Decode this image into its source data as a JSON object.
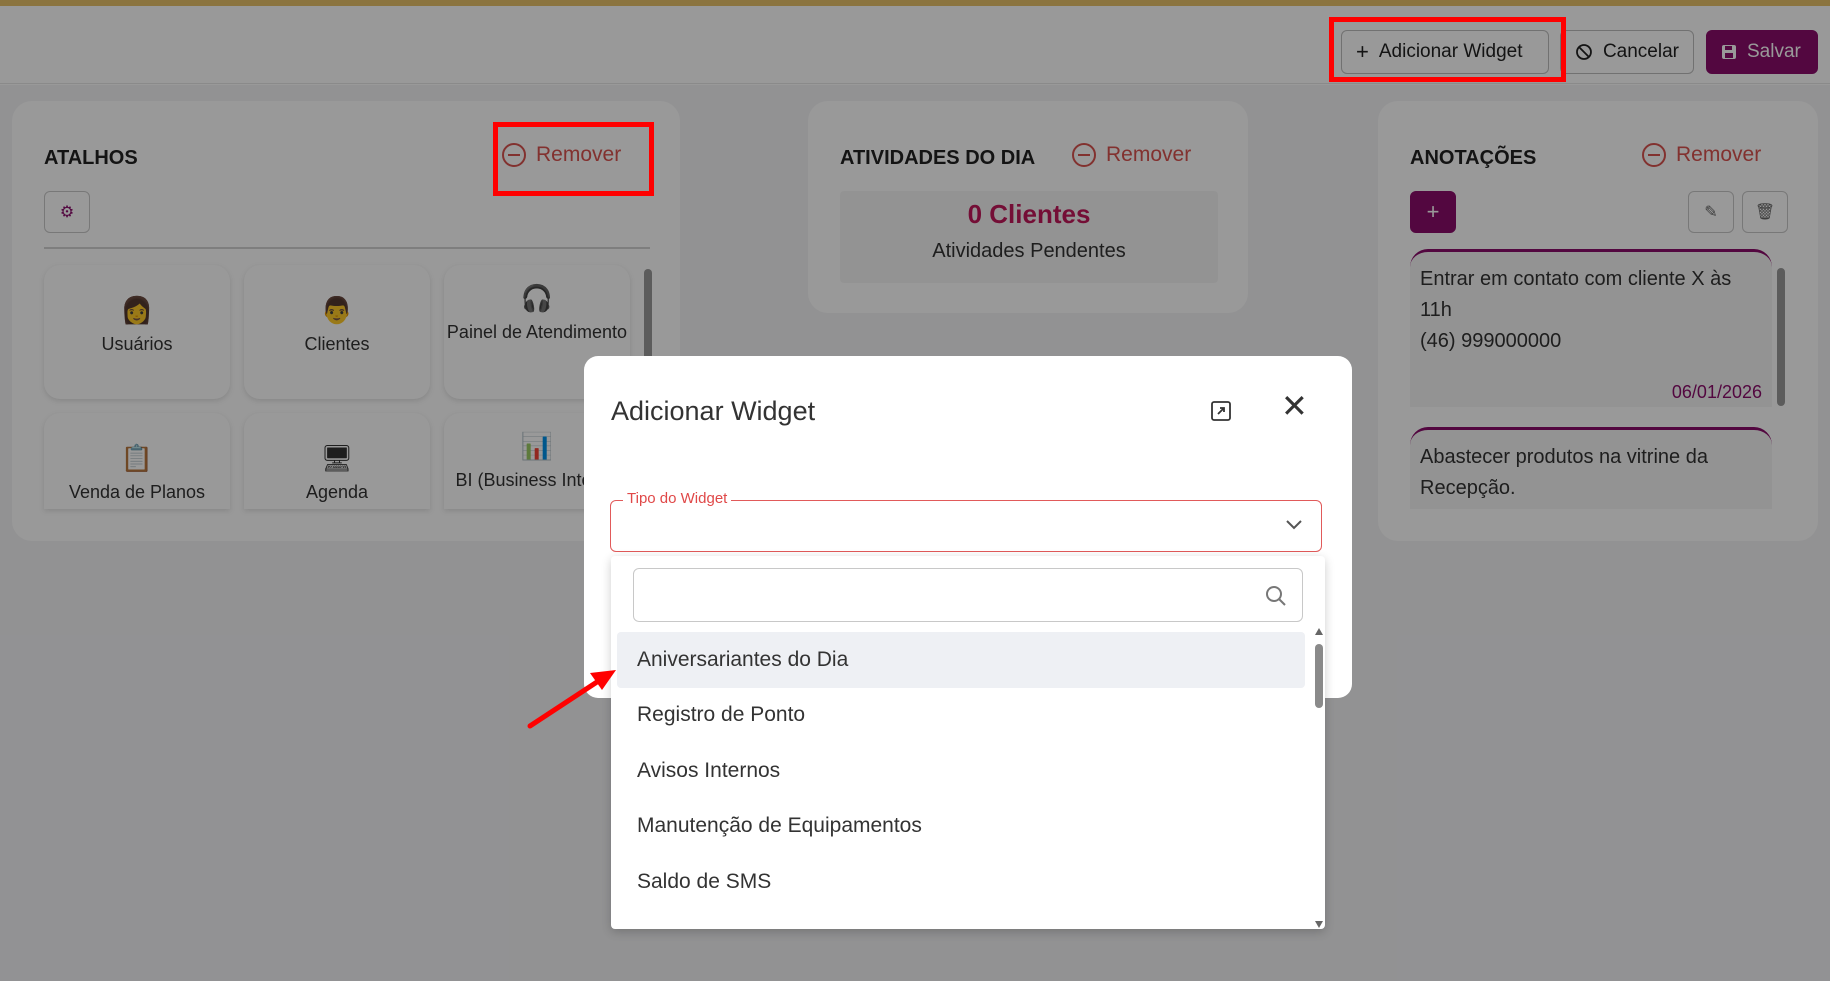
{
  "colors": {
    "primary": "#8a0d6b",
    "danger": "#d9534f",
    "highlight": "#ff0000",
    "accent": "#c2185b"
  },
  "toolbar": {
    "add_widget": "Adicionar Widget",
    "cancel": "Cancelar",
    "save": "Salvar",
    "add_icon": "plus-icon",
    "cancel_icon": "ban-icon",
    "save_icon": "floppy-icon"
  },
  "widgets": {
    "atalhos": {
      "title": "ATALHOS",
      "remove": "Remover",
      "shortcuts": [
        {
          "label": "Usuários",
          "icon": "user-woman-icon"
        },
        {
          "label": "Clientes",
          "icon": "user-man-icon"
        },
        {
          "label": "Painel de Atendimento",
          "icon": "headset-agent-icon"
        },
        {
          "label": "Venda de Planos",
          "icon": "clipboard-pen-icon"
        },
        {
          "label": "Agenda",
          "icon": "calendar-monitor-icon"
        },
        {
          "label": "BI (Business Intelli...",
          "icon": "bi-chart-icon"
        }
      ]
    },
    "atividades": {
      "title": "ATIVIDADES DO DIA",
      "remove": "Remover",
      "count": "0 Clientes",
      "label": "Atividades Pendentes"
    },
    "anotacoes": {
      "title": "ANOTAÇÕES",
      "remove": "Remover",
      "notes": [
        {
          "text": "Entrar em contato com cliente X às 11h\n(46) 999000000",
          "date": "06/01/2026"
        },
        {
          "text": "Abastecer produtos na vitrine da Recepção."
        }
      ]
    }
  },
  "modal": {
    "title": "Adicionar Widget",
    "field_label": "Tipo do Widget",
    "search_placeholder": "",
    "options": [
      "Aniversariantes do Dia",
      "Registro de Ponto",
      "Avisos Internos",
      "Manutenção de Equipamentos",
      "Saldo de SMS"
    ],
    "active_option": "Aniversariantes do Dia"
  }
}
